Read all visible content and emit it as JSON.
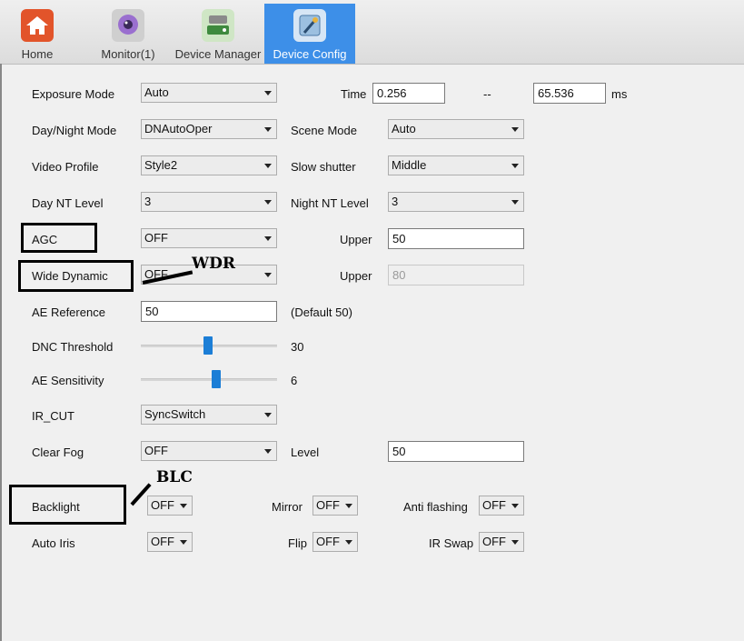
{
  "tabs": [
    {
      "label": "Home",
      "icon": "home-icon",
      "active": false
    },
    {
      "label": "Monitor(1)",
      "icon": "monitor-icon",
      "active": false
    },
    {
      "label": "Device Manager",
      "icon": "device-manager-icon",
      "active": false
    },
    {
      "label": "Device Config",
      "icon": "device-config-icon",
      "active": true
    }
  ],
  "form": {
    "exposure_mode": {
      "label": "Exposure Mode",
      "value": "Auto"
    },
    "time": {
      "label": "Time",
      "min": "0.256",
      "sep": "--",
      "max": "65.536",
      "unit": "ms"
    },
    "day_night_mode": {
      "label": "Day/Night Mode",
      "value": "DNAutoOper"
    },
    "scene_mode": {
      "label": "Scene Mode",
      "value": "Auto"
    },
    "video_profile": {
      "label": "Video Profile",
      "value": "Style2"
    },
    "slow_shutter": {
      "label": "Slow shutter",
      "value": "Middle"
    },
    "day_nt_level": {
      "label": "Day NT Level",
      "value": "3"
    },
    "night_nt_level": {
      "label": "Night NT Level",
      "value": "3"
    },
    "agc": {
      "label": "AGC",
      "value": "OFF",
      "upper_label": "Upper",
      "upper_value": "50"
    },
    "wide_dynamic": {
      "label": "Wide Dynamic",
      "value": "OFF",
      "upper_label": "Upper",
      "upper_value": "80"
    },
    "ae_reference": {
      "label": "AE Reference",
      "value": "50",
      "hint": "(Default 50)"
    },
    "dnc_threshold": {
      "label": "DNC Threshold",
      "value": "30",
      "fraction": 0.49
    },
    "ae_sensitivity": {
      "label": "AE Sensitivity",
      "value": "6",
      "fraction": 0.55
    },
    "ir_cut": {
      "label": "IR_CUT",
      "value": "SyncSwitch"
    },
    "clear_fog": {
      "label": "Clear Fog",
      "value": "OFF",
      "level_label": "Level",
      "level_value": "50"
    },
    "backlight": {
      "label": "Backlight",
      "value": "OFF"
    },
    "mirror": {
      "label": "Mirror",
      "value": "OFF"
    },
    "anti_flashing": {
      "label": "Anti flashing",
      "value": "OFF"
    },
    "auto_iris": {
      "label": "Auto Iris",
      "value": "OFF"
    },
    "flip": {
      "label": "Flip",
      "value": "OFF"
    },
    "ir_swap": {
      "label": "IR Swap",
      "value": "OFF"
    }
  },
  "annotations": {
    "wdr": "WDR",
    "blc": "BLC"
  }
}
